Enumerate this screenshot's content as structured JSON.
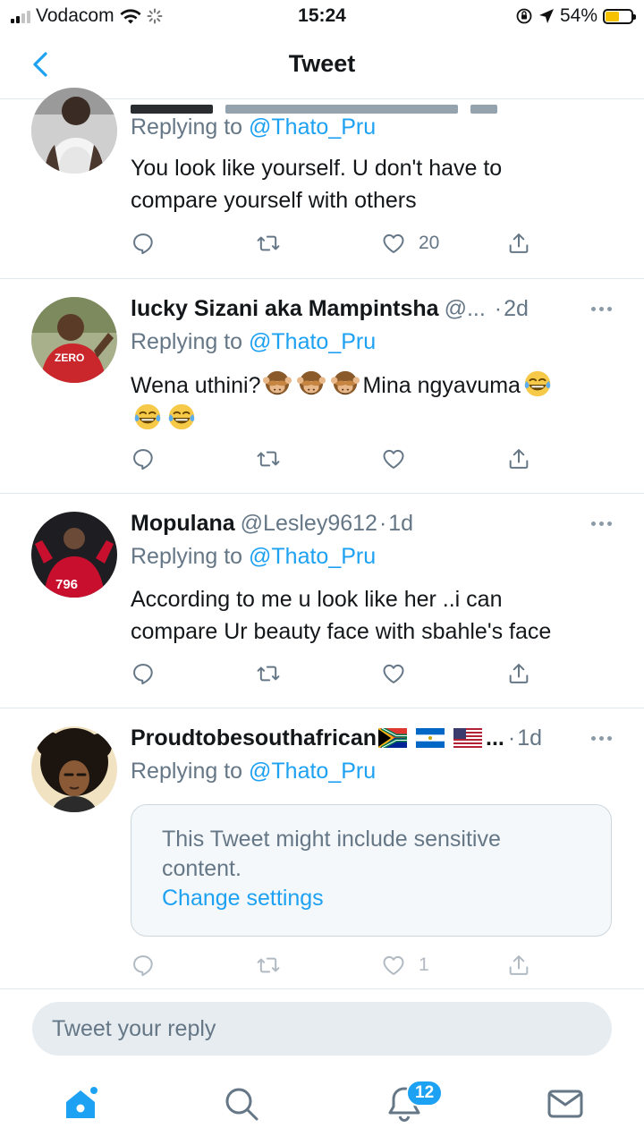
{
  "status_bar": {
    "carrier": "Vodacom",
    "time": "15:24",
    "battery": "54%",
    "battery_level": 0.54
  },
  "header": {
    "title": "Tweet"
  },
  "tweets": [
    {
      "replying_prefix": "Replying to",
      "replying_to": "@Thato_Pru",
      "text_lines": [
        "You look like yourself.  U don't have to",
        "compare yourself with others"
      ],
      "like_count": "20"
    },
    {
      "name": "lucky Sizani aka Mampintsha",
      "handle": "@...",
      "dot": "·",
      "time": "2d",
      "replying_prefix": "Replying to",
      "replying_to": "@Thato_Pru",
      "text_part1": "Wena uthini?",
      "text_part2": "Mina ngyavuma",
      "emojis": [
        "see-no-evil-monkey",
        "tears-of-joy"
      ]
    },
    {
      "name": "Mopulana",
      "handle": "@Lesley9612",
      "dot": "·",
      "time": "1d",
      "replying_prefix": "Replying to",
      "replying_to": "@Thato_Pru",
      "avatar_text": "796",
      "text_lines": [
        "According to me u look like her ..i can",
        "compare Ur beauty face with sbahle's face"
      ]
    },
    {
      "name": "Proudtobesouthafrican",
      "name_suffix": "...",
      "dot": "·",
      "time": "1d",
      "flags": [
        "south-africa-flag",
        "nicaragua-flag",
        "usa-flag"
      ],
      "replying_prefix": "Replying to",
      "replying_to": "@Thato_Pru",
      "sensitive_message_lines": [
        "This Tweet might include sensitive",
        "content."
      ],
      "sensitive_link": "Change settings",
      "like_count": "1"
    }
  ],
  "reply_box": {
    "placeholder": "Tweet your reply"
  },
  "tab_bar": {
    "notification_badge": "12",
    "icons": [
      "home-icon",
      "search-icon",
      "notifications-icon",
      "messages-icon"
    ]
  },
  "colors": {
    "accent": "#1da1f2",
    "text": "#14171a",
    "secondary": "#657786"
  }
}
